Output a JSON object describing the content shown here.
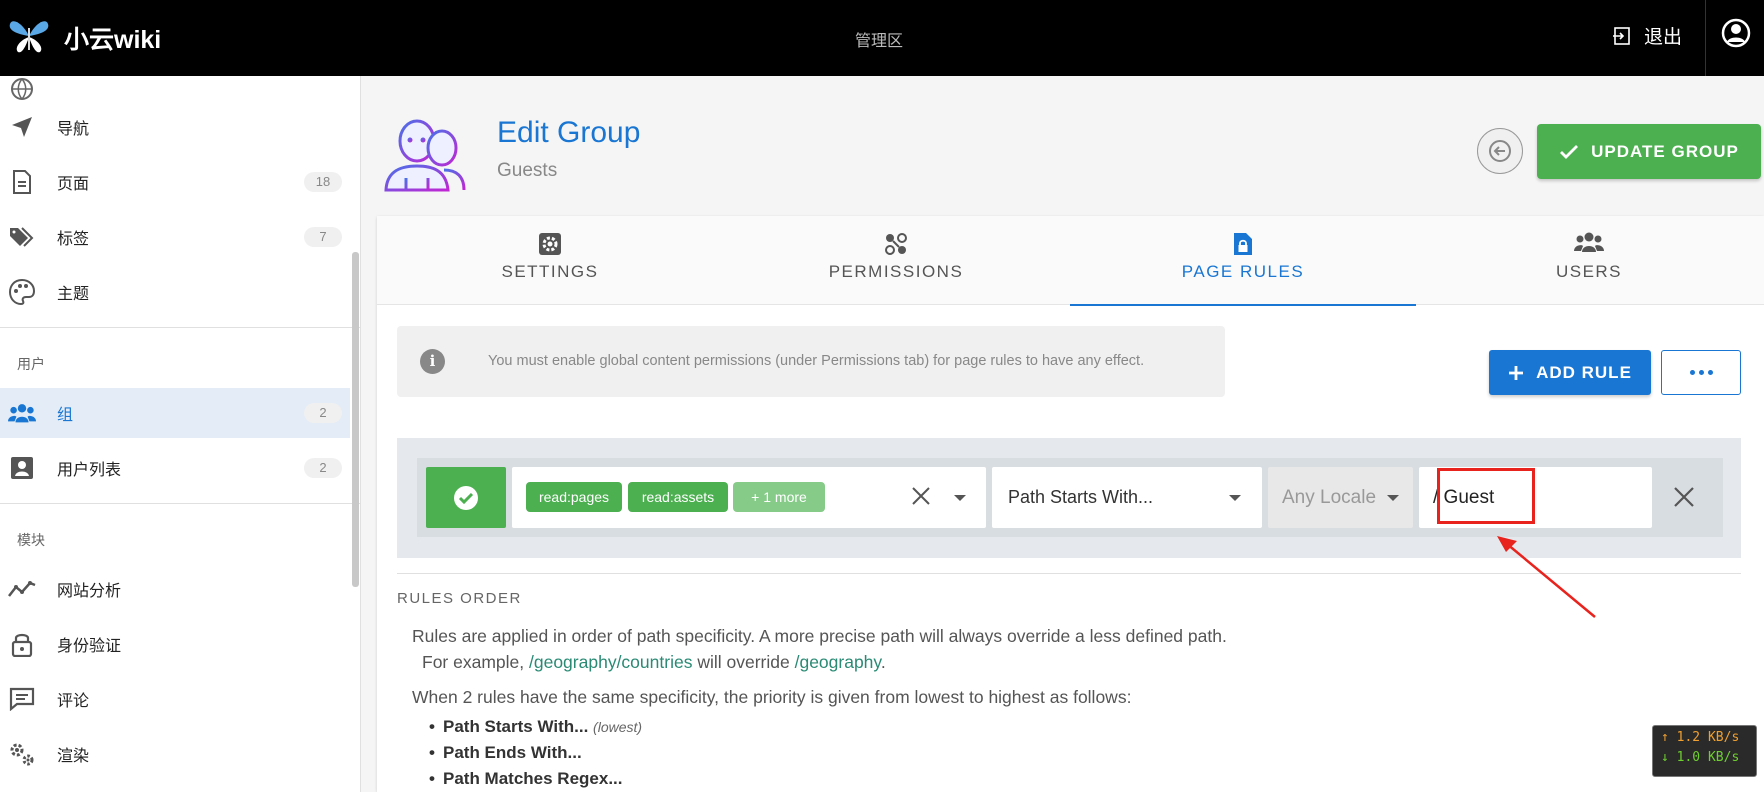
{
  "topbar": {
    "site_title": "小云wiki",
    "admin_label": "管理区",
    "logout_label": "退出"
  },
  "sidebar": {
    "items": [
      {
        "label": "导航",
        "icon": "send-icon"
      },
      {
        "label": "页面",
        "icon": "page-icon",
        "badge": "18"
      },
      {
        "label": "标签",
        "icon": "tags-icon",
        "badge": "7"
      },
      {
        "label": "主题",
        "icon": "palette-icon"
      }
    ],
    "users_section": "用户",
    "user_items": [
      {
        "label": "组",
        "icon": "groups-icon",
        "badge": "2",
        "active": true
      },
      {
        "label": "用户列表",
        "icon": "user-list-icon",
        "badge": "2"
      }
    ],
    "modules_section": "模块",
    "module_items": [
      {
        "label": "网站分析",
        "icon": "analytics-icon"
      },
      {
        "label": "身份验证",
        "icon": "lock-icon"
      },
      {
        "label": "评论",
        "icon": "comment-icon"
      },
      {
        "label": "渲染",
        "icon": "gears-icon"
      }
    ]
  },
  "header": {
    "title": "Edit Group",
    "subtitle": "Guests",
    "update_label": "UPDATE GROUP"
  },
  "tabs": [
    {
      "label": "SETTINGS",
      "icon": "gear-icon"
    },
    {
      "label": "PERMISSIONS",
      "icon": "permissions-icon"
    },
    {
      "label": "PAGE RULES",
      "icon": "file-lock-icon",
      "active": true
    },
    {
      "label": "USERS",
      "icon": "users-icon"
    }
  ],
  "alert": {
    "text": "You must enable global content permissions (under Permissions tab) for page rules to have any effect."
  },
  "actions": {
    "add_rule_label": "ADD RULE"
  },
  "rule": {
    "permissions": [
      "read:pages",
      "read:assets"
    ],
    "more_chip": "+ 1 more",
    "match": "Path Starts With...",
    "locale": "Any Locale",
    "path": "/ Guest"
  },
  "rules_order": {
    "heading": "RULES ORDER",
    "line1": "Rules are applied in order of path specificity. A more precise path will always override a less defined path.",
    "line2_prefix": "For example,",
    "line2_link1": "/geography/countries",
    "line2_middle": "will override",
    "line2_link2": "/geography",
    "line2_suffix": ".",
    "line3": "When 2 rules have the same specificity, the priority is given from lowest to highest as follows:",
    "list": [
      "Path Starts With...",
      "Path Ends With...",
      "Path Matches Regex..."
    ],
    "lowest_note": "(lowest)"
  },
  "speed": {
    "up": "↑ 1.2 KB/s",
    "down": "↓ 1.0 KB/s"
  },
  "colors": {
    "accent": "#1976d2",
    "success": "#4caf50",
    "highlight": "#e8231d"
  }
}
